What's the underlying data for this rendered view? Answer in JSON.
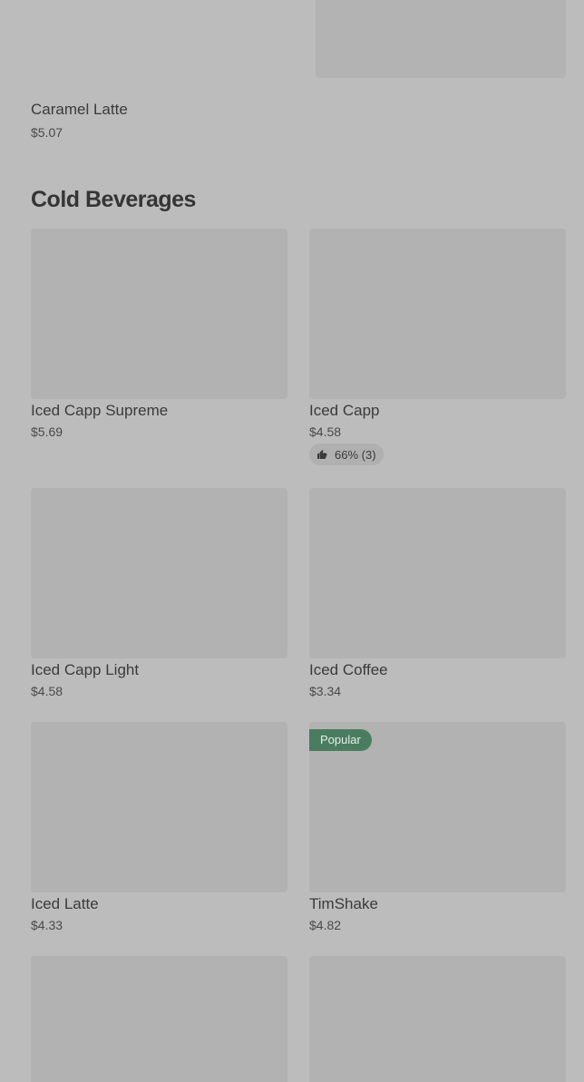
{
  "previous_item": {
    "name": "Caramel Latte",
    "price": "$5.07"
  },
  "section": {
    "title": "Cold Beverages"
  },
  "items": [
    {
      "name": "Iced Capp Supreme",
      "price": "$5.69"
    },
    {
      "name": "Iced Capp",
      "price": "$4.58",
      "rating": "66% (3)",
      "rating_icon": "thumbs-up-icon"
    },
    {
      "name": "Iced Capp Light",
      "price": "$4.58"
    },
    {
      "name": "Iced Coffee",
      "price": "$3.34"
    },
    {
      "name": "Iced Latte",
      "price": "$4.33"
    },
    {
      "name": "TimShake",
      "price": "$4.82",
      "badge": "Popular",
      "badge_color": "#4a7d5f"
    }
  ],
  "colors": {
    "background": "#bcbcbc",
    "image_placeholder": "#b2b2b2",
    "text": "#3b3b3b",
    "badge": "#4a7d5f"
  }
}
